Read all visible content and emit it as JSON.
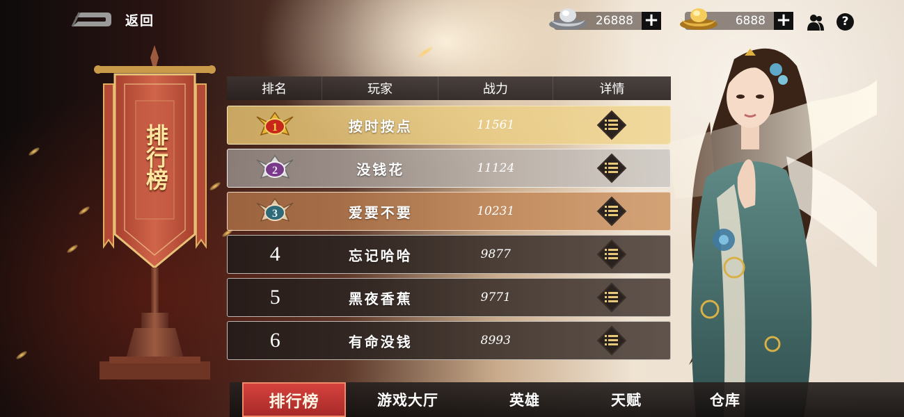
{
  "header": {
    "back_label": "返回",
    "silver_amount": "26888",
    "gold_amount": "6888",
    "add_symbol": "+",
    "help_symbol": "?"
  },
  "banner": {
    "title": "排行榜"
  },
  "table": {
    "columns": [
      "排名",
      "玩家",
      "战力",
      "详情"
    ],
    "rows": [
      {
        "rank": "1",
        "player": "按时按点",
        "power": "11561"
      },
      {
        "rank": "2",
        "player": "没钱花",
        "power": "11124"
      },
      {
        "rank": "3",
        "player": "爱要不要",
        "power": "10231"
      },
      {
        "rank": "4",
        "player": "忘记哈哈",
        "power": "9877"
      },
      {
        "rank": "5",
        "player": "黑夜香蕉",
        "power": "9771"
      },
      {
        "rank": "6",
        "player": "有命没钱",
        "power": "8993"
      }
    ]
  },
  "tabs": [
    {
      "label": "排行榜",
      "active": true
    },
    {
      "label": "游戏大厅",
      "active": false
    },
    {
      "label": "英雄",
      "active": false
    },
    {
      "label": "天赋",
      "active": false
    },
    {
      "label": "仓库",
      "active": false
    }
  ],
  "icons": {
    "back": "back-arrow-icon",
    "silver": "silver-ingot-icon",
    "gold": "gold-ingot-icon",
    "friends": "friends-icon",
    "help": "help-icon",
    "detail": "detail-list-icon",
    "medal_gold": "gold-medal-icon",
    "medal_silver": "silver-medal-icon",
    "medal_bronze": "bronze-medal-icon"
  },
  "colors": {
    "active_tab": "#c23a36",
    "banner_red": "#c2533c",
    "gold_row": "#e9cc8c"
  }
}
